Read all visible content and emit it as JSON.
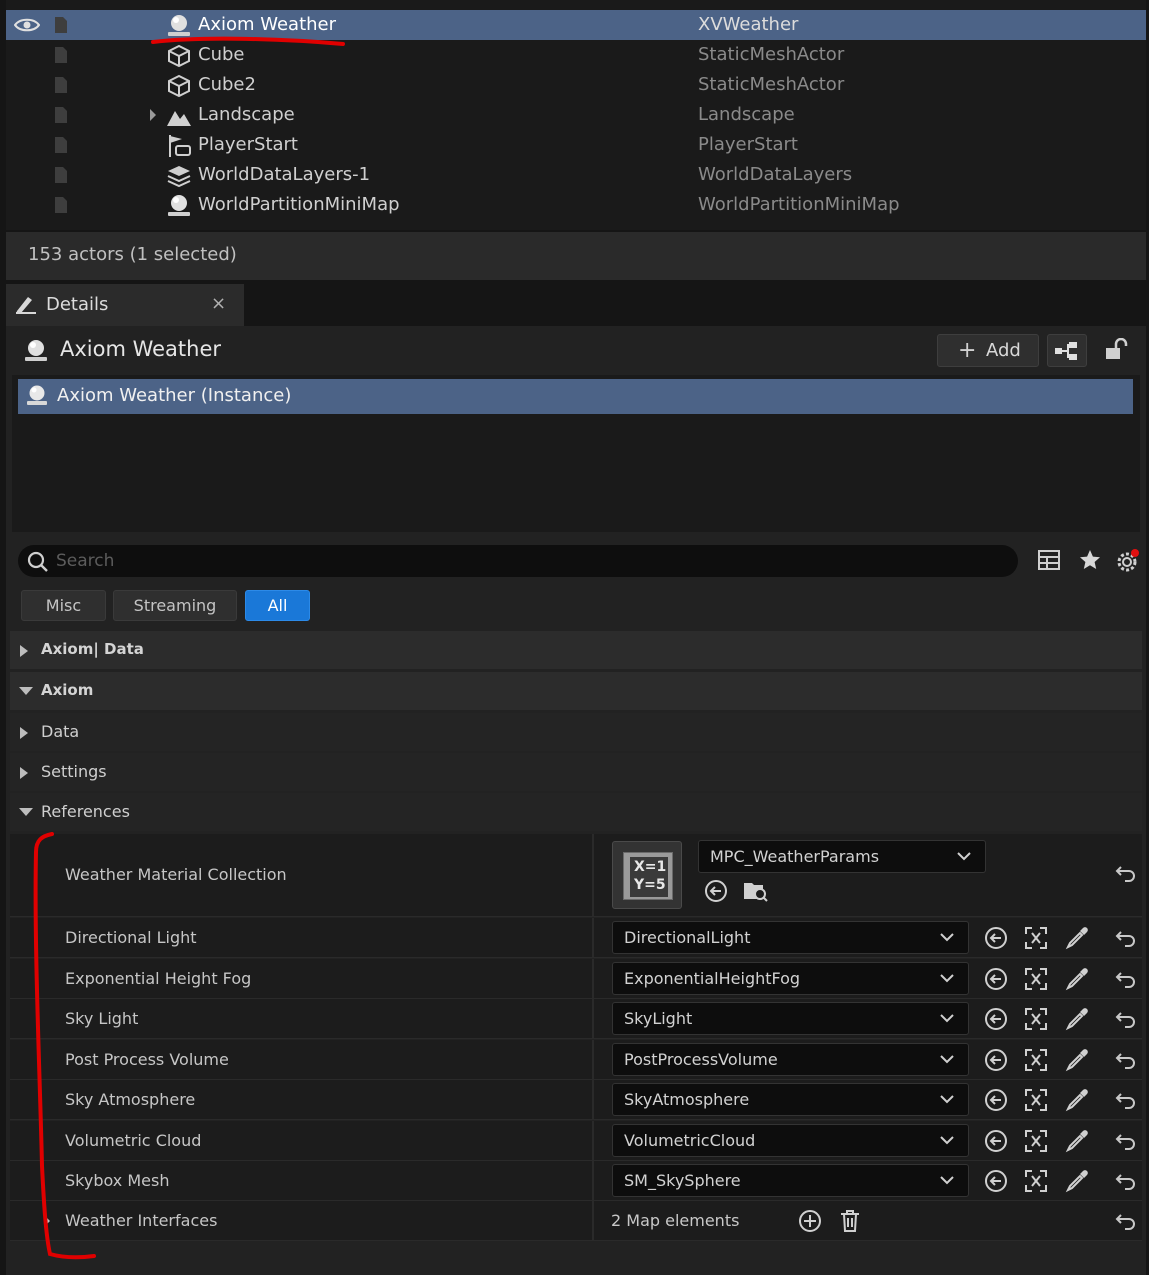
{
  "outliner": {
    "rows": [
      {
        "name": "Axiom Weather",
        "type": "XVWeather",
        "icon": "sphere-actor-icon",
        "selected": true
      },
      {
        "name": "Cube",
        "type": "StaticMeshActor",
        "icon": "cube-icon"
      },
      {
        "name": "Cube2",
        "type": "StaticMeshActor",
        "icon": "cube-icon"
      },
      {
        "name": "Landscape",
        "type": "Landscape",
        "icon": "landscape-icon",
        "expandable": true
      },
      {
        "name": "PlayerStart",
        "type": "PlayerStart",
        "icon": "player-start-icon"
      },
      {
        "name": "WorldDataLayers-1",
        "type": "WorldDataLayers",
        "icon": "layers-icon"
      },
      {
        "name": "WorldPartitionMiniMap",
        "type": "WorldPartitionMiniMap",
        "icon": "sphere-actor-icon"
      }
    ],
    "status": "153 actors (1 selected)"
  },
  "details": {
    "tab_label": "Details",
    "tab_close": "×",
    "actor_title": "Axiom Weather",
    "add_label": "Add",
    "component": "Axiom Weather (Instance)",
    "search_placeholder": "Search",
    "filters": [
      "Misc",
      "Streaming",
      "All"
    ],
    "active_filter": "All",
    "categories": {
      "axiom_data": "Axiom| Data",
      "axiom": "Axiom",
      "data": "Data",
      "settings": "Settings",
      "references": "References"
    },
    "weather_material": {
      "label": "Weather Material Collection",
      "value": "MPC_WeatherParams",
      "thumb_line1": "X=1",
      "thumb_line2": "Y=5"
    },
    "references": [
      {
        "label": "Directional Light",
        "value": "DirectionalLight"
      },
      {
        "label": "Exponential Height Fog",
        "value": "ExponentialHeightFog"
      },
      {
        "label": "Sky Light",
        "value": "SkyLight"
      },
      {
        "label": "Post Process Volume",
        "value": "PostProcessVolume"
      },
      {
        "label": "Sky Atmosphere",
        "value": "SkyAtmosphere"
      },
      {
        "label": "Volumetric Cloud",
        "value": "VolumetricCloud"
      },
      {
        "label": "Skybox Mesh",
        "value": "SM_SkySphere"
      }
    ],
    "weather_interfaces": {
      "label": "Weather Interfaces",
      "value": "2 Map elements"
    }
  },
  "colors": {
    "selection": "#4c6387",
    "accent": "#1a78d8",
    "annotation": "#e00000"
  }
}
